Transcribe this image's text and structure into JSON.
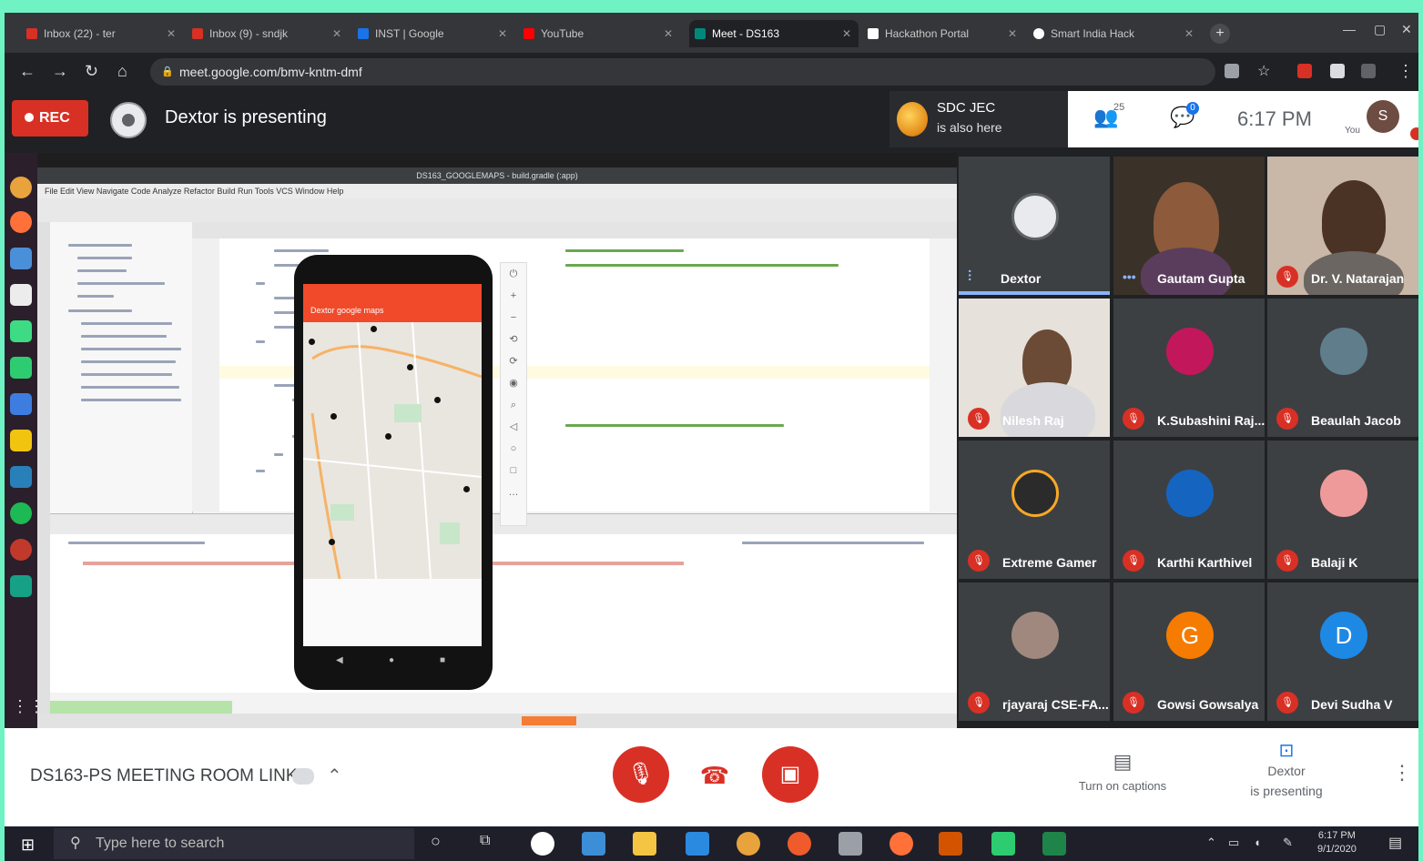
{
  "browser": {
    "tabs": [
      {
        "label": "Inbox (22) - ter",
        "color": "#d93025"
      },
      {
        "label": "Inbox (9) - sndjk",
        "color": "#d93025"
      },
      {
        "label": "INST | Google",
        "color": "#1a73e8"
      },
      {
        "label": "YouTube",
        "color": "#ff0000"
      },
      {
        "label": "Meet - DS163",
        "color": "#00897b"
      },
      {
        "label": "Hackathon Portal",
        "color": "#ffffff"
      },
      {
        "label": "Smart India Hack",
        "color": "#ffffff"
      }
    ],
    "url": "meet.google.com/bmv-kntm-dmf"
  },
  "meet": {
    "rec_label": "REC",
    "presenting_text": "Dextor is presenting",
    "notice": {
      "name": "SDC JEC",
      "status": "is also here"
    },
    "people_count": "25",
    "chat_badge": "0",
    "time": "6:17 PM",
    "self": {
      "label": "You",
      "initial": "S"
    },
    "meeting_name": "DS163-PS MEETING ROOM LINK",
    "captions_label": "Turn on captions",
    "presenter_btn": {
      "line1": "Dextor",
      "line2": "is presenting"
    }
  },
  "presentation": {
    "ide_title": "DS163_GOOGLEMAPS - build.gradle (:app)",
    "ide_menu": "File Edit View Navigate Code Analyze Refactor Build Run Tools VCS Window Help",
    "app_title": "Dextor google maps"
  },
  "participants": [
    {
      "name": "Dextor",
      "kind": "presenter",
      "status": "speaking"
    },
    {
      "name": "Gautam Gupta",
      "kind": "camera",
      "status": "active"
    },
    {
      "name": "Dr. V. Natarajan",
      "kind": "camera",
      "status": "muted"
    },
    {
      "name": "Nilesh Raj",
      "kind": "camera",
      "status": "muted"
    },
    {
      "name": "K.Subashini Raj...",
      "kind": "avatar",
      "status": "muted",
      "color": "#c2185b"
    },
    {
      "name": "Beaulah Jacob",
      "kind": "avatar",
      "status": "muted",
      "color": "#607d8b"
    },
    {
      "name": "Extreme Gamer",
      "kind": "avatar",
      "status": "muted",
      "color": "#f9a825"
    },
    {
      "name": "Karthi Karthivel",
      "kind": "avatar",
      "status": "muted",
      "color": "#1565c0"
    },
    {
      "name": "Balaji K",
      "kind": "avatar",
      "status": "muted",
      "color": "#ef9a9a"
    },
    {
      "name": "rjayaraj CSE-FA...",
      "kind": "avatar",
      "status": "muted",
      "color": "#a1887f"
    },
    {
      "name": "Gowsi Gowsalya",
      "kind": "letter",
      "letter": "G",
      "status": "muted",
      "color": "#f57c00"
    },
    {
      "name": "Devi Sudha V",
      "kind": "letter",
      "letter": "D",
      "status": "muted",
      "color": "#1e88e5"
    }
  ],
  "taskbar": {
    "search_placeholder": "Type here to search",
    "time": "6:17 PM",
    "date": "9/1/2020"
  }
}
